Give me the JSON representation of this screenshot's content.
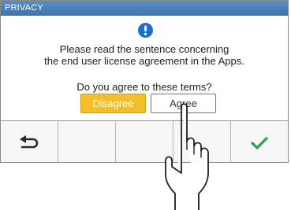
{
  "header": {
    "title": "PRIVACY"
  },
  "icons": {
    "info": "info-icon",
    "back": "back-arrow-icon",
    "confirm": "checkmark-icon"
  },
  "dialog": {
    "message_line1": "Please read the sentence concerning",
    "message_line2": "the end user license agreement in the Apps.",
    "question": "Do you agree to these terms?"
  },
  "buttons": {
    "disagree": "Disagree",
    "agree": "Agree"
  },
  "colors": {
    "title_bar": "#4a7fb5",
    "disagree_bg": "#f2be2a",
    "info_icon": "#1e6fc9",
    "checkmark": "#2aa760"
  }
}
